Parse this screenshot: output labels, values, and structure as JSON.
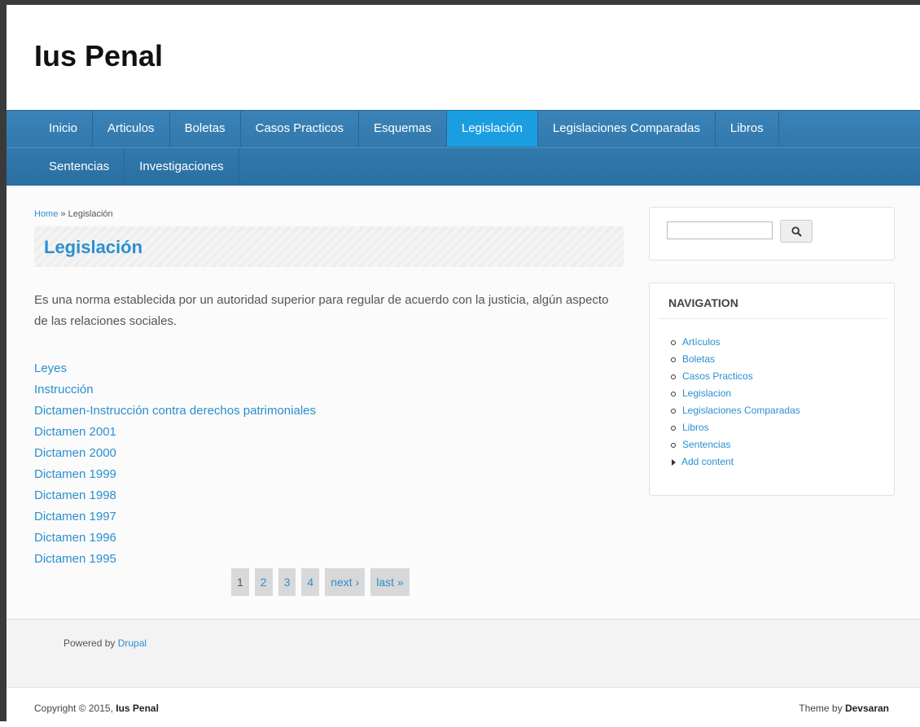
{
  "site": {
    "name": "Ius Penal"
  },
  "menu": {
    "row1": [
      "Inicio",
      "Articulos",
      "Boletas",
      "Casos Practicos",
      "Esquemas",
      "Legislación",
      "Legislaciones Comparadas",
      "Libros"
    ],
    "row2": [
      "Sentencias",
      "Investigaciones"
    ],
    "active": "Legislación"
  },
  "breadcrumb": {
    "home": "Home",
    "separator": "»",
    "current": "Legislación"
  },
  "page": {
    "title": "Legislación",
    "description": "Es una norma establecida por un autoridad superior para regular de acuerdo con la justicia, algún aspecto de las relaciones sociales.",
    "items": [
      "Leyes",
      "Instrucción",
      "Dictamen-Instrucción contra derechos patrimoniales",
      "Dictamen 2001",
      "Dictamen 2000",
      "Dictamen 1999",
      "Dictamen 1998",
      "Dictamen 1997",
      "Dictamen 1996",
      "Dictamen 1995"
    ]
  },
  "pager": {
    "pages": [
      "1",
      "2",
      "3",
      "4"
    ],
    "current": "1",
    "next": "next ›",
    "last": "last »"
  },
  "search": {
    "value": "",
    "button_icon": "search-icon"
  },
  "navigation": {
    "title": "NAVIGATION",
    "items": [
      "Artículos",
      "Boletas",
      "Casos Practicos",
      "Legislacion",
      "Legislaciones Comparadas",
      "Libros",
      "Sentencias"
    ],
    "add_content": "Add content"
  },
  "footer": {
    "powered_prefix": "Powered by",
    "powered_link": "Drupal",
    "copyright_prefix": "Copyright © 2015,",
    "copyright_site": "Ius Penal",
    "theme_prefix": "Theme by",
    "theme_author": "Devsaran"
  },
  "colors": {
    "nav": "#2f78ad",
    "active": "#1b9de2",
    "link": "#2a8fd0"
  }
}
